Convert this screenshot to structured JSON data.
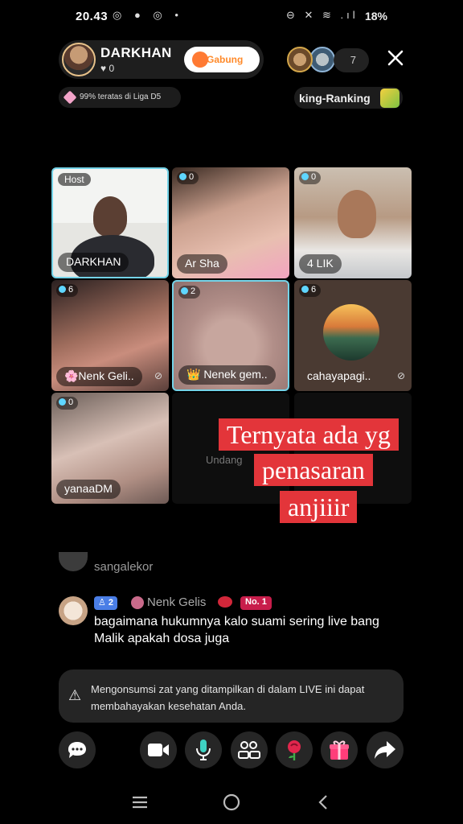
{
  "status_bar": {
    "time": "20.43",
    "left_icons": "◎ ● ◎ •",
    "right_icons": "⊖ ✕ ≋ .ıl",
    "battery": "18%"
  },
  "host": {
    "name": "DARKHAN",
    "likes": "♥ 0",
    "join_label": "Gabung"
  },
  "viewers": {
    "count": "7"
  },
  "league": {
    "text": "99% teratas di Liga D5"
  },
  "ranking": {
    "label": "king-Ranking"
  },
  "grid": {
    "tiles": [
      {
        "badge": "Host",
        "name": "DARKHAN"
      },
      {
        "badge": "0",
        "name": "Ar Sha"
      },
      {
        "badge": "0",
        "name": "4 LIK"
      },
      {
        "badge": "6",
        "name": "🌸Nenk Geli.."
      },
      {
        "badge": "2",
        "name": "👑 Nenek gem.."
      },
      {
        "badge": "6",
        "name": "cahayapagi.."
      },
      {
        "badge": "0",
        "name": "yanaaDM"
      },
      {
        "invite": "Undang"
      }
    ]
  },
  "caption": {
    "line1": "Ternyata ada yg",
    "line2": "penasaran",
    "line3": "anjiiir"
  },
  "chat": {
    "previous_user": "sangalekor",
    "comment": {
      "level": "2",
      "user": "Nenk Gelis",
      "badge": "No. 1",
      "text": "bagaimana hukumnya kalo suami sering live bang Malik apakah dosa juga"
    }
  },
  "warning": {
    "text": "Mengonsumsi zat yang ditampilkan di dalam LIVE ini dapat membahayakan kesehatan Anda."
  },
  "colors": {
    "accent_orange": "#ff8a2a",
    "caption_red": "#e3353a",
    "active_tile_border": "#74d3e8",
    "badge_red": "#c81d4b",
    "level_blue": "#4a7ee6"
  },
  "icons": {
    "actions": [
      "chat-bubble-icon",
      "video-camera-icon",
      "microphone-icon",
      "guests-icon",
      "rose-gift-icon",
      "gift-box-icon",
      "share-arrow-icon"
    ],
    "nav": [
      "recent-apps-icon",
      "home-icon",
      "back-icon"
    ]
  }
}
